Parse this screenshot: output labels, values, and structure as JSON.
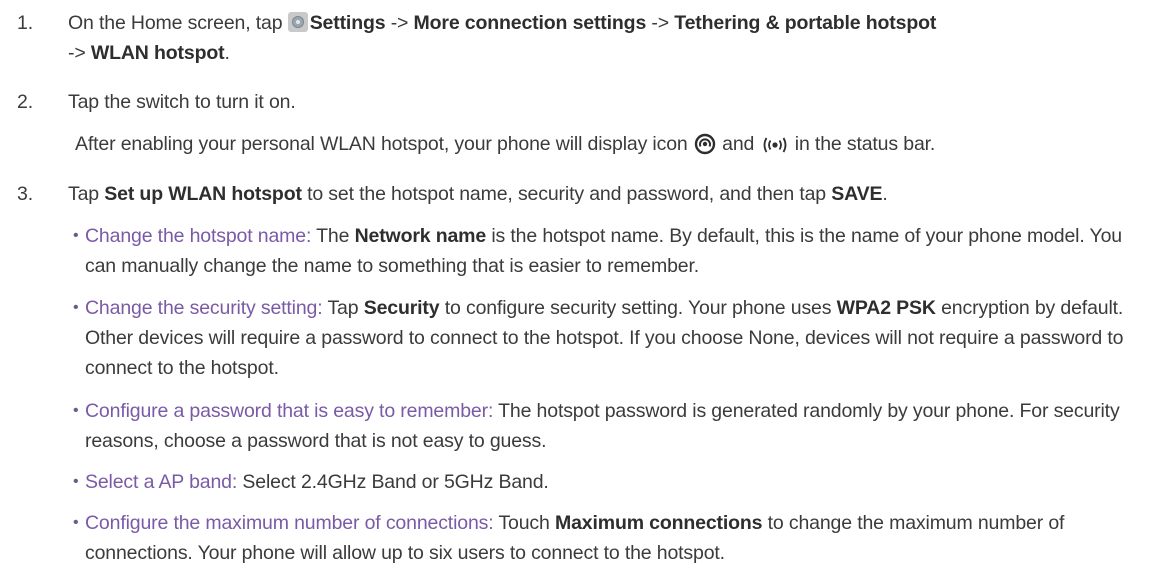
{
  "steps": [
    {
      "number": "1.",
      "segments": [
        "On the Home screen, tap ",
        "Settings",
        " -> ",
        "More connection settings",
        " -> ",
        "Tethering & portable hotspot",
        " -> ",
        "WLAN hotspot",
        "."
      ]
    },
    {
      "number": "2.",
      "text": "Tap the switch to turn it on.",
      "note": [
        "After enabling your personal WLAN hotspot, your phone will display icon ",
        " and ",
        " in the status bar."
      ]
    },
    {
      "number": "3.",
      "segments": [
        "Tap ",
        "Set up WLAN hotspot",
        " to set the hotspot name, security and password, and then tap ",
        "SAVE",
        "."
      ]
    }
  ],
  "bullets": [
    {
      "heading": "Change the hotspot name:",
      "segments": [
        " The ",
        "Network name",
        " is the hotspot name. By default, this is the name of your phone model. You can manually change the name to something that is easier to remember."
      ]
    },
    {
      "heading": "Change the security setting:",
      "segments": [
        " Tap ",
        "Security",
        " to configure security setting. Your phone uses ",
        "WPA2 PSK",
        " encryption by default. Other devices will require a password to connect to the hotspot. If you choose None, devices will not require a password to connect to the hotspot."
      ]
    },
    {
      "heading": "Configure a password that is easy to remember:",
      "segments": [
        " The hotspot password is generated randomly by your phone. For security reasons, choose a password that is not easy to guess."
      ]
    },
    {
      "heading": "Select a AP band:",
      "segments": [
        " Select 2.4GHz Band or 5GHz Band."
      ]
    },
    {
      "heading": "Configure the maximum number of connections:",
      "segments": [
        " Touch ",
        "Maximum connections",
        " to change the maximum number of connections. Your phone will allow up to six users to connect to the hotspot."
      ]
    }
  ],
  "bullet_glyph": "•",
  "icons": [
    "settings-gear-icon",
    "hotspot-icon",
    "broadcast-icon"
  ],
  "colors": {
    "text": "#3b3b3b",
    "highlight": "#7a5aa6"
  }
}
